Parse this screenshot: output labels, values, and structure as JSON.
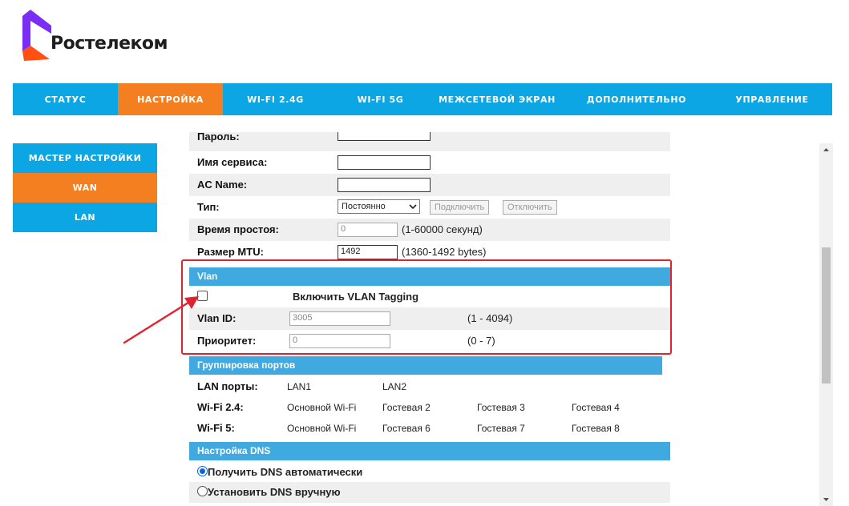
{
  "brand": {
    "name": "Ростелеком"
  },
  "topnav": {
    "tabs": [
      {
        "label": "СТАТУС",
        "active": false
      },
      {
        "label": "НАСТРОЙКА",
        "active": true
      },
      {
        "label": "WI-FI 2.4G",
        "active": false
      },
      {
        "label": "WI-FI 5G",
        "active": false
      },
      {
        "label": "МЕЖСЕТЕВОЙ ЭКРАН",
        "active": false
      },
      {
        "label": "ДОПОЛНИТЕЛЬНО",
        "active": false
      },
      {
        "label": "УПРАВЛЕНИЕ",
        "active": false
      }
    ]
  },
  "sidebar": {
    "items": [
      {
        "label": "МАСТЕР НАСТРОЙКИ",
        "active": false
      },
      {
        "label": "WAN",
        "active": true
      },
      {
        "label": "LAN",
        "active": false
      }
    ]
  },
  "form": {
    "password_label": "Пароль:",
    "service_label": "Имя сервиса:",
    "service_value": "",
    "ac_label": "AC Name:",
    "ac_value": "",
    "type_label": "Тип:",
    "type_selected": "Постоянно",
    "connect_label": "Подключить",
    "disconnect_label": "Отключить",
    "idle_label": "Время простоя:",
    "idle_value": "0",
    "idle_hint": "(1-60000 секунд)",
    "mtu_label": "Размер MTU:",
    "mtu_value": "1492",
    "mtu_hint": "(1360-1492 bytes)"
  },
  "vlan": {
    "heading": "Vlan",
    "enable_label": "Включить VLAN Tagging",
    "enabled": false,
    "id_label": "Vlan ID:",
    "id_value": "3005",
    "id_hint": "(1 - 4094)",
    "priority_label": "Приоритет:",
    "priority_value": "0",
    "priority_hint": "(0 - 7)"
  },
  "ports": {
    "heading": "Группировка портов",
    "lan_label": "LAN порты:",
    "lan": [
      "LAN1",
      "LAN2"
    ],
    "wifi24_label": "Wi-Fi 2.4:",
    "wifi24": [
      "Основной Wi-Fi",
      "Гостевая 2",
      "Гостевая 3",
      "Гостевая 4"
    ],
    "wifi5_label": "Wi-Fi 5:",
    "wifi5": [
      "Основной Wi-Fi",
      "Гостевая 6",
      "Гостевая 7",
      "Гостевая 8"
    ]
  },
  "dns": {
    "heading": "Настройка DNS",
    "auto_label": "Получить DNS автоматически",
    "manual_label": "Установить DNS вручную",
    "selected": "auto"
  },
  "colors": {
    "nav_blue": "#0ba6e3",
    "active_orange": "#f47f20",
    "section_blue": "#3fa9e0",
    "annotation_red": "#e0242f"
  }
}
